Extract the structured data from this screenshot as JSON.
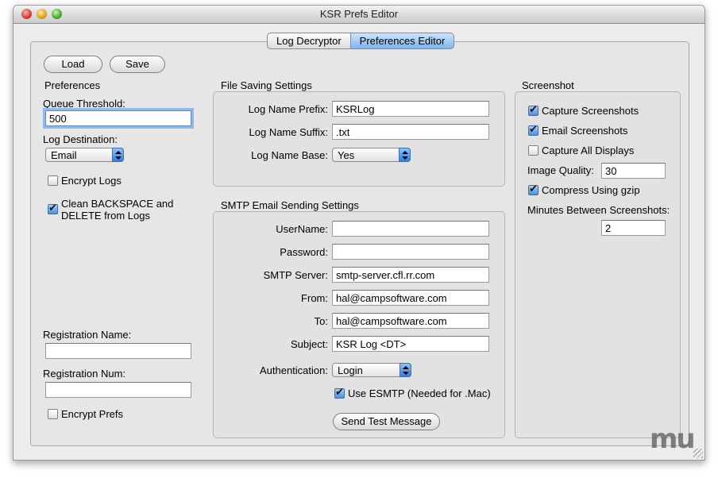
{
  "window": {
    "title": "KSR Prefs Editor"
  },
  "tabs": [
    {
      "label": "Log Decryptor",
      "active": false
    },
    {
      "label": "Preferences Editor",
      "active": true
    }
  ],
  "toolbar": {
    "load_label": "Load",
    "save_label": "Save"
  },
  "preferences": {
    "heading": "Preferences",
    "queue_threshold_label": "Queue Threshold:",
    "queue_threshold_value": "500",
    "log_destination_label": "Log Destination:",
    "log_destination_value": "Email",
    "encrypt_logs_label": "Encrypt Logs",
    "encrypt_logs_checked": false,
    "clean_label_line1": "Clean BACKSPACE and",
    "clean_label_line2": "DELETE from Logs",
    "clean_checked": true,
    "registration_name_label": "Registration Name:",
    "registration_name_value": "",
    "registration_num_label": "Registration Num:",
    "registration_num_value": "",
    "encrypt_prefs_label": "Encrypt Prefs",
    "encrypt_prefs_checked": false
  },
  "file_saving": {
    "heading": "File Saving Settings",
    "prefix_label": "Log Name Prefix:",
    "prefix_value": "KSRLog",
    "suffix_label": "Log Name Suffix:",
    "suffix_value": ".txt",
    "base_label": "Log Name Base:",
    "base_value": "Yes"
  },
  "smtp": {
    "heading": "SMTP Email Sending Settings",
    "username_label": "UserName:",
    "username_value": "",
    "password_label": "Password:",
    "password_value": "",
    "server_label": "SMTP Server:",
    "server_value": "smtp-server.cfl.rr.com",
    "from_label": "From:",
    "from_value": "hal@campsoftware.com",
    "to_label": "To:",
    "to_value": "hal@campsoftware.com",
    "subject_label": "Subject:",
    "subject_value": "KSR Log <DT>",
    "auth_label": "Authentication:",
    "auth_value": "Login",
    "esmtp_label": "Use ESMTP (Needed for .Mac)",
    "esmtp_checked": true,
    "send_test_label": "Send Test Message"
  },
  "screenshot": {
    "heading": "Screenshot",
    "capture_label": "Capture Screenshots",
    "capture_checked": true,
    "email_label": "Email Screenshots",
    "email_checked": true,
    "all_displays_label": "Capture All Displays",
    "all_displays_checked": false,
    "quality_label": "Image Quality:",
    "quality_value": "30",
    "gzip_label": "Compress Using gzip",
    "gzip_checked": true,
    "minutes_label": "Minutes Between Screenshots:",
    "minutes_value": "2"
  },
  "watermark": "mu"
}
